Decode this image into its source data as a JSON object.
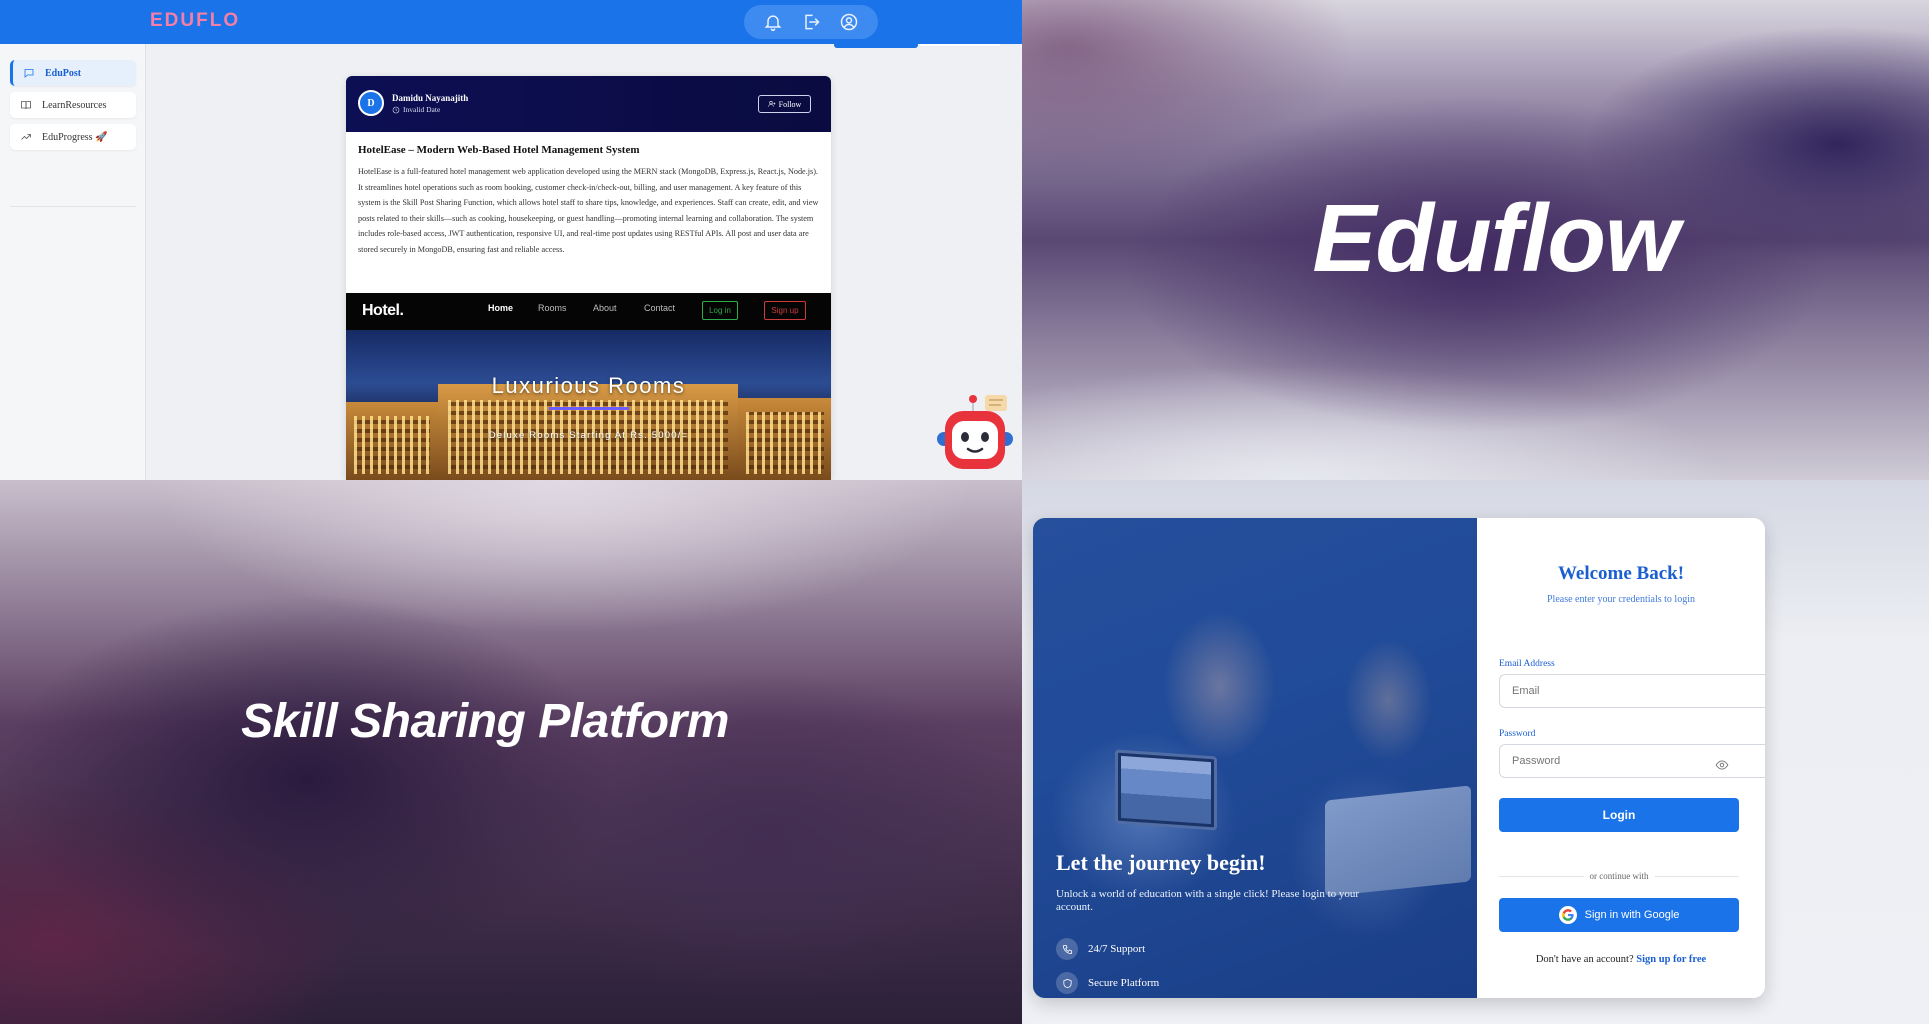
{
  "app": {
    "logo": "EDUFLO",
    "topbar_icons": [
      "bell-icon",
      "logout-icon",
      "user-circle-icon"
    ],
    "sidebar": {
      "items": [
        {
          "label": "EduPost",
          "icon": "message-square-icon",
          "active": true
        },
        {
          "label": "LearnResources",
          "icon": "book-open-icon",
          "active": false
        },
        {
          "label": "EduProgress 🚀",
          "icon": "trending-up-icon",
          "active": false
        }
      ]
    },
    "post": {
      "avatar_initial": "D",
      "author": "Damidu Nayanajith",
      "date": "Invalid Date",
      "follow_label": "Follow",
      "title": "HotelEase – Modern Web-Based Hotel Management System",
      "body": "HotelEase is a full-featured hotel management web application developed using the MERN stack (MongoDB, Express.js, React.js, Node.js). It streamlines hotel operations such as room booking, customer check-in/check-out, billing, and user management. A key feature of this system is the Skill Post Sharing Function, which allows hotel staff to share tips, knowledge, and experiences. Staff can create, edit, and view posts related to their skills—such as cooking, housekeeping, or guest handling—promoting internal learning and collaboration. The system includes role-based access, JWT authentication, responsive UI, and real-time post updates using RESTful APIs. All post and user data are stored securely in MongoDB, ensuring fast and reliable access.",
      "image": {
        "logo": "Hotel.",
        "nav": [
          "Home",
          "Rooms",
          "About",
          "Contact"
        ],
        "login_label": "Log in",
        "signup_label": "Sign up",
        "headline": "Luxurious Rooms",
        "tagline": "Deluxe Rooms Starting At Rs. 5000/="
      }
    },
    "bot_icon": "robot-assistant-icon"
  },
  "brand": {
    "title": "Eduflow"
  },
  "skill": {
    "title": "Skill Sharing Platform"
  },
  "login": {
    "hero_title": "Let the journey begin!",
    "hero_subtitle": "Unlock a world of education with a single click! Please login to your account.",
    "features": [
      {
        "label": "24/7 Support",
        "icon": "phone-icon"
      },
      {
        "label": "Secure Platform",
        "icon": "shield-icon"
      }
    ],
    "welcome": "Welcome Back!",
    "welcome_sub": "Please enter your credentials to login",
    "email_label": "Email Address",
    "email_placeholder": "Email",
    "password_label": "Password",
    "password_placeholder": "Password",
    "login_button": "Login",
    "divider": "or continue with",
    "google_button": "Sign in with Google",
    "no_account": "Don't have an account?",
    "signup_link": "Sign up for free",
    "colors": {
      "primary": "#1a73e8",
      "heading": "#1a5fd0"
    }
  }
}
